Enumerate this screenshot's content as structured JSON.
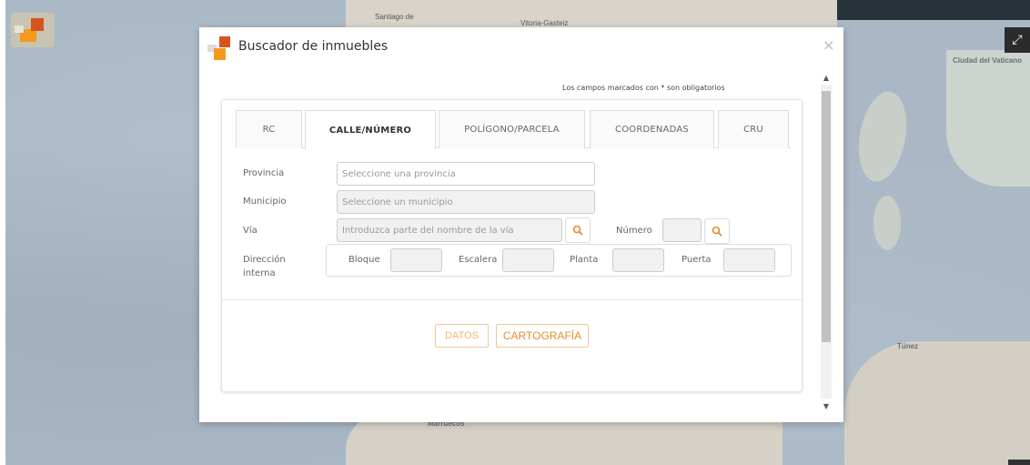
{
  "map": {
    "labels": {
      "vaticano": "Ciudad del Vaticano",
      "tunez": "Túnez",
      "marruecos": "Marruecos",
      "santiago": "Santiago de",
      "vitoria": "Vitoria-Gasteiz"
    }
  },
  "modal": {
    "title": "Buscador de inmuebles",
    "close": "×",
    "required_note": "Los campos marcados con * son obligatorios",
    "tabs": [
      {
        "label": "RC"
      },
      {
        "label": "CALLE/NÚMERO"
      },
      {
        "label": "POLÍGONO/PARCELA"
      },
      {
        "label": "COORDENADAS"
      },
      {
        "label": "CRU"
      }
    ],
    "active_tab": "CALLE/NÚMERO",
    "form": {
      "provincia_label": "Provincia",
      "provincia_placeholder": "Seleccione una provincia",
      "municipio_label": "Municipio",
      "municipio_placeholder": "Seleccione un municipio",
      "via_label": "Vía",
      "via_placeholder": "Introduzca parte del nombre de la vía",
      "numero_label": "Número",
      "direccion_label_1": "Dirección",
      "direccion_label_2": "interna",
      "bloque_label": "Bloque",
      "escalera_label": "Escalera",
      "planta_label": "Planta",
      "puerta_label": "Puerta"
    },
    "buttons": {
      "datos": "DATOS",
      "cartografia": "CARTOGRAFÍA"
    }
  },
  "colors": {
    "accent": "#e48d2a",
    "logo_orange": "#f39a1e",
    "logo_red": "#d9531e"
  }
}
